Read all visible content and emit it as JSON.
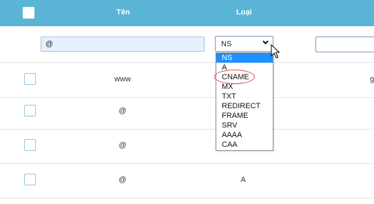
{
  "header": {
    "name_col": "Tên",
    "type_col": "Loại"
  },
  "filter": {
    "name_value": "@",
    "type_selected": "NS"
  },
  "type_options": [
    "NS",
    "A",
    "CNAME",
    "MX",
    "TXT",
    "REDIRECT",
    "FRAME",
    "SRV",
    "AAAA",
    "CAA"
  ],
  "rows": [
    {
      "name": "www",
      "type": "",
      "clip": "g"
    },
    {
      "name": "@",
      "type": ""
    },
    {
      "name": "@",
      "type": ""
    },
    {
      "name": "@",
      "type": "A"
    }
  ],
  "colors": {
    "header_bg": "#5ab4d6",
    "selected_option": "#1e90ff",
    "highlight": "#e04040"
  }
}
